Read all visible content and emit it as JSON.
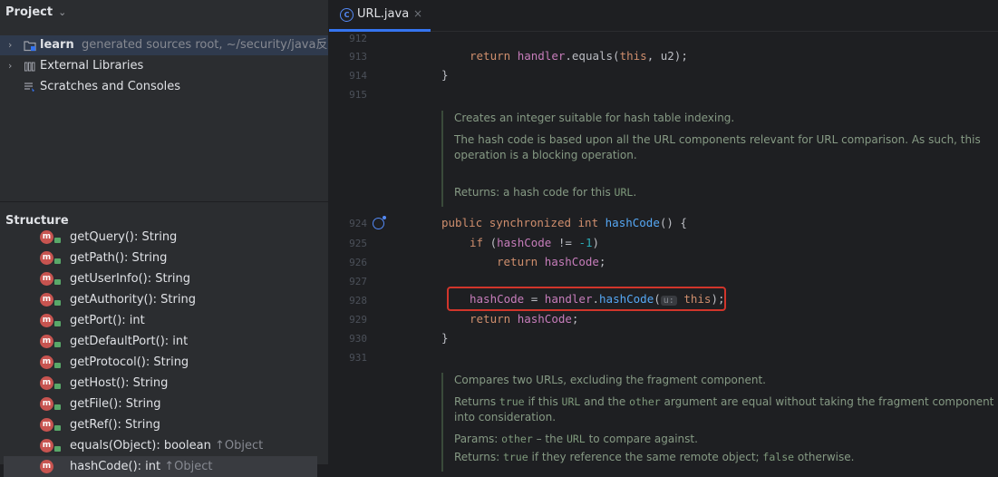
{
  "project": {
    "title": "Project",
    "tree": [
      {
        "name": "learn",
        "extra": "generated sources root,  ~/security/java反序列化"
      },
      {
        "name": "External Libraries"
      },
      {
        "name": "Scratches and Consoles"
      }
    ]
  },
  "structure": {
    "title": "Structure",
    "methods": [
      {
        "label": "getQuery(): String",
        "extra": ""
      },
      {
        "label": "getPath(): String",
        "extra": ""
      },
      {
        "label": "getUserInfo(): String",
        "extra": ""
      },
      {
        "label": "getAuthority(): String",
        "extra": ""
      },
      {
        "label": "getPort(): int",
        "extra": ""
      },
      {
        "label": "getDefaultPort(): int",
        "extra": ""
      },
      {
        "label": "getProtocol(): String",
        "extra": ""
      },
      {
        "label": "getHost(): String",
        "extra": ""
      },
      {
        "label": "getFile(): String",
        "extra": ""
      },
      {
        "label": "getRef(): String",
        "extra": ""
      },
      {
        "label": "equals(Object): boolean",
        "extra": "↑Object"
      },
      {
        "label": "hashCode(): int",
        "extra": "↑Object"
      }
    ]
  },
  "editor": {
    "tab": {
      "label": "URL.java",
      "close": "×"
    },
    "lines": [
      "912",
      "913",
      "914",
      "915",
      "924",
      "925",
      "926",
      "927",
      "928",
      "929",
      "930",
      "931"
    ],
    "code": {
      "l913_return": "return",
      "l913_handler": "handler",
      "l913_equals": ".equals(",
      "l913_this": "this",
      "l913_end": ", u2);",
      "brace_close": "}",
      "l924_public": "public",
      "l924_sync": "synchronized",
      "l924_int": "int",
      "l924_name": "hashCode",
      "l924_end": "() {",
      "l925_if": "if",
      "l925_open": "(",
      "l925_field": "hashCode",
      "l925_neq": " != ",
      "l925_num": "-1",
      "l925_close": ")",
      "l926_return": "return",
      "l926_field": "hashCode",
      "semicolon": ";",
      "l928_field": "hashCode",
      "l928_eq": " = ",
      "l928_handler": "handler",
      "l928_dot": ".",
      "l928_call": "hashCode",
      "l928_paren": "(",
      "l928_hint": "u:",
      "l928_this": "this",
      "l928_end": ");",
      "l929_return": "return",
      "l929_field": "hashCode"
    },
    "doc1": {
      "p1": "Creates an integer suitable for hash table indexing.",
      "p2": "The hash code is based upon all the URL components relevant for URL comparison. As such, this operation is a blocking operation.",
      "returns_label": "Returns:",
      "returns_text": "a hash code for this",
      "returns_code": "URL",
      "returns_end": "."
    },
    "doc2": {
      "p1": "Compares two URLs, excluding the fragment component.",
      "p2a": "Returns",
      "p2b": "true",
      "p2c": "if this",
      "p2d": "URL",
      "p2e": "and the",
      "p2f": "other",
      "p2g": "argument are equal without taking the fragment component into consideration.",
      "params_label": "Params:",
      "params_code": "other",
      "params_text": "– the",
      "params_code2": "URL",
      "params_end": "to compare against.",
      "returns_label": "Returns:",
      "returns_code": "true",
      "returns_text": "if they reference the same remote object;",
      "returns_code2": "false",
      "returns_end": "otherwise."
    }
  }
}
